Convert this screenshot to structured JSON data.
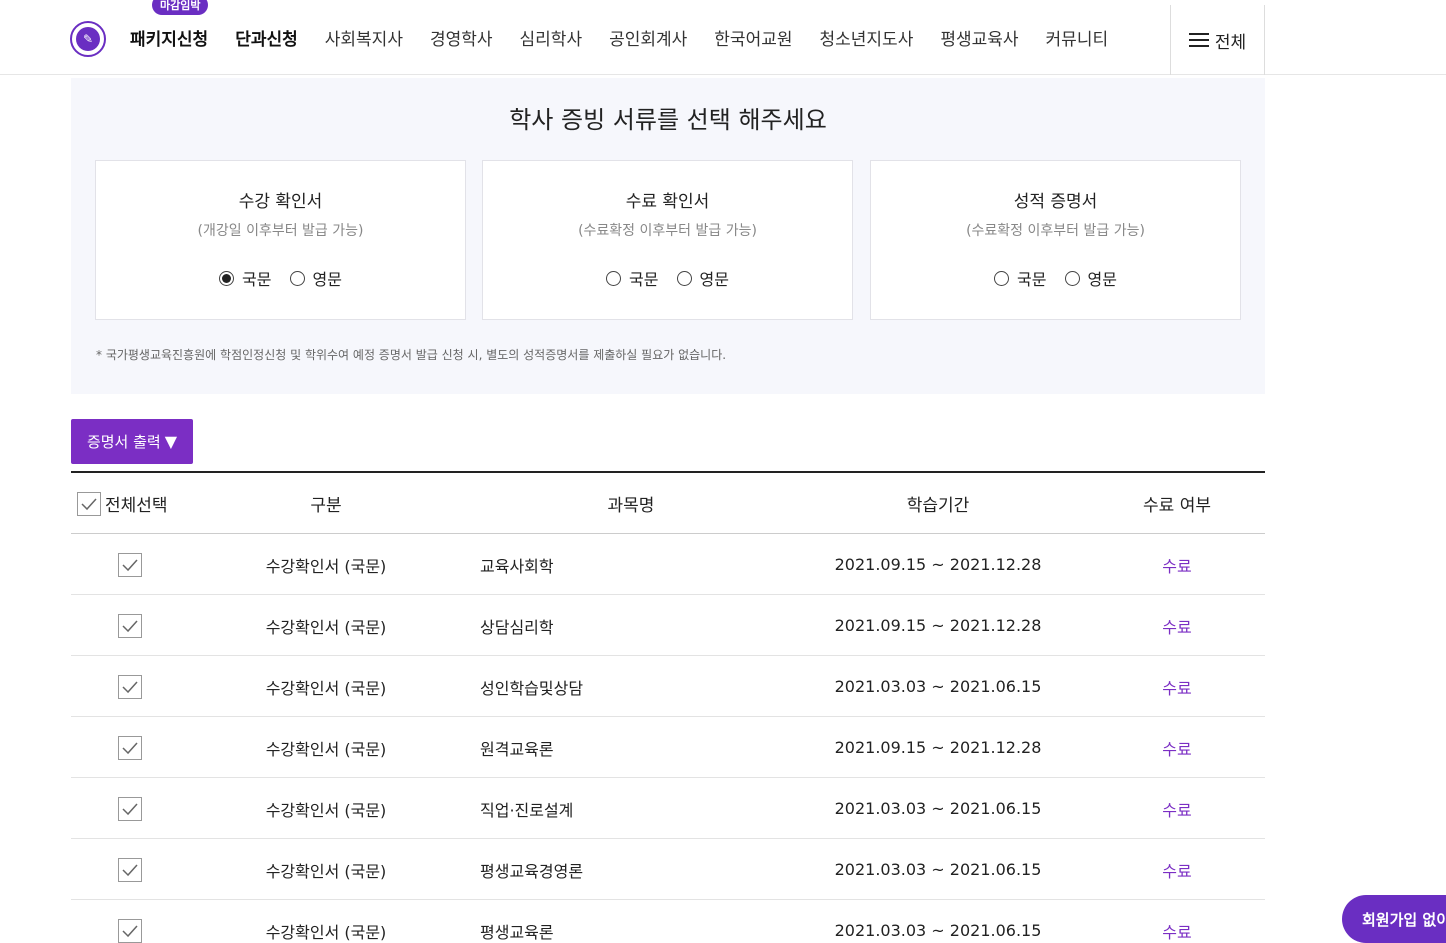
{
  "header": {
    "logo_icon": "university-seal-icon",
    "nav": [
      {
        "label": "패키지신청",
        "bold": true,
        "badge": "마감임박"
      },
      {
        "label": "단과신청",
        "bold": true
      },
      {
        "label": "사회복지사"
      },
      {
        "label": "경영학사"
      },
      {
        "label": "심리학사"
      },
      {
        "label": "공인회계사"
      },
      {
        "label": "한국어교원"
      },
      {
        "label": "청소년지도사"
      },
      {
        "label": "평생교육사"
      },
      {
        "label": "커뮤니티"
      }
    ],
    "menu_label": "전체"
  },
  "panel": {
    "title": "학사 증빙 서류를 선택 해주세요",
    "cards": [
      {
        "title": "수강 확인서",
        "sub": "(개강일 이후부터 발급 가능)",
        "options": [
          "국문",
          "영문"
        ],
        "selected": "국문"
      },
      {
        "title": "수료 확인서",
        "sub": "(수료확정 이후부터 발급 가능)",
        "options": [
          "국문",
          "영문"
        ],
        "selected": ""
      },
      {
        "title": "성적 증명서",
        "sub": "(수료확정 이후부터 발급 가능)",
        "options": [
          "국문",
          "영문"
        ],
        "selected": ""
      }
    ],
    "note": "* 국가평생교육진흥원에 학점인정신청 및 학위수여 예정 증명서 발급 신청 시, 별도의 성적증명서를 제출하실 필요가 없습니다."
  },
  "print_button": {
    "label": "증명서 출력",
    "icon": "triangle-down-icon"
  },
  "table": {
    "headers": {
      "select_all": "전체선택",
      "type": "구분",
      "subject": "과목명",
      "period": "학습기간",
      "status": "수료 여부"
    },
    "rows": [
      {
        "type": "수강확인서 (국문)",
        "subject": "교육사회학",
        "period": "2021.09.15 ~ 2021.12.28",
        "status": "수료"
      },
      {
        "type": "수강확인서 (국문)",
        "subject": "상담심리학",
        "period": "2021.09.15 ~ 2021.12.28",
        "status": "수료"
      },
      {
        "type": "수강확인서 (국문)",
        "subject": "성인학습및상담",
        "period": "2021.03.03 ~ 2021.06.15",
        "status": "수료"
      },
      {
        "type": "수강확인서 (국문)",
        "subject": "원격교육론",
        "period": "2021.09.15 ~ 2021.12.28",
        "status": "수료"
      },
      {
        "type": "수강확인서 (국문)",
        "subject": "직업·진로설계",
        "period": "2021.03.03 ~ 2021.06.15",
        "status": "수료"
      },
      {
        "type": "수강확인서 (국문)",
        "subject": "평생교육경영론",
        "period": "2021.03.03 ~ 2021.06.15",
        "status": "수료"
      },
      {
        "type": "수강확인서 (국문)",
        "subject": "평생교육론",
        "period": "2021.03.03 ~ 2021.06.15",
        "status": "수료"
      }
    ]
  },
  "float_button": {
    "label": "회원가입 없이"
  }
}
